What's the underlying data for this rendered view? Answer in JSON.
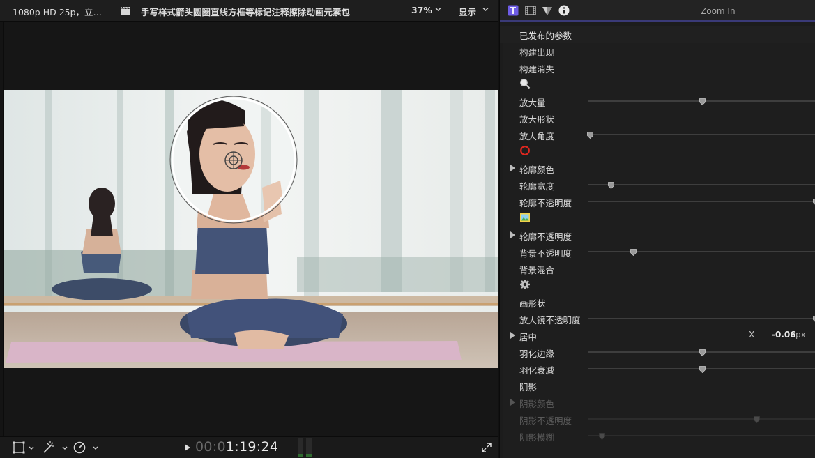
{
  "viewer": {
    "video_format": "1080p HD 25p，立…",
    "project_title": "手写样式箭头圆圈直线方框等标记注释擦除动画元素包",
    "zoom_level": "37%",
    "display_menu": "显示"
  },
  "footer": {
    "timecode_dim": "00:0",
    "timecode_bright": "1:19:24"
  },
  "inspector": {
    "title": "Zoom In",
    "params_title": "已发布的参数",
    "rows": [
      {
        "label": "构建出现"
      },
      {
        "label": "构建消失"
      },
      {
        "icon": "magnifier-icon"
      },
      {
        "label": "放大量",
        "slider": 0.5
      },
      {
        "label": "放大形状"
      },
      {
        "label": "放大角度",
        "slider": 0.01
      },
      {
        "icon": "red-circle-icon"
      },
      {
        "label": "轮廓颜色",
        "disclosure": true
      },
      {
        "label": "轮廓宽度",
        "slider": 0.1
      },
      {
        "label": "轮廓不透明度",
        "slider": 1.0
      },
      {
        "icon": "image-icon"
      },
      {
        "label": "轮廓不透明度",
        "disclosure": true
      },
      {
        "label": "背景不透明度",
        "slider": 0.2
      },
      {
        "label": "背景混合"
      },
      {
        "icon": "gear-icon"
      },
      {
        "label": "画形状"
      },
      {
        "label": "放大镜不透明度",
        "slider": 1.0
      },
      {
        "label": "居中",
        "disclosure": true,
        "x_label": "X",
        "x_value": "-0.06",
        "x_unit": "px"
      },
      {
        "label": "羽化边缘",
        "slider": 0.5
      },
      {
        "label": "羽化衰减",
        "slider": 0.5
      },
      {
        "label": "阴影"
      },
      {
        "label": "阴影颜色",
        "disclosure": true,
        "dim": true
      },
      {
        "label": "阴影不透明度",
        "slider": 0.74,
        "dim": true
      },
      {
        "label": "阴影模糊",
        "slider": 0.06,
        "dim": true
      }
    ]
  },
  "colors": {
    "accent": "#3a3a78",
    "tab_active": "#6e5ce6",
    "red_circle": "#e0271f"
  }
}
